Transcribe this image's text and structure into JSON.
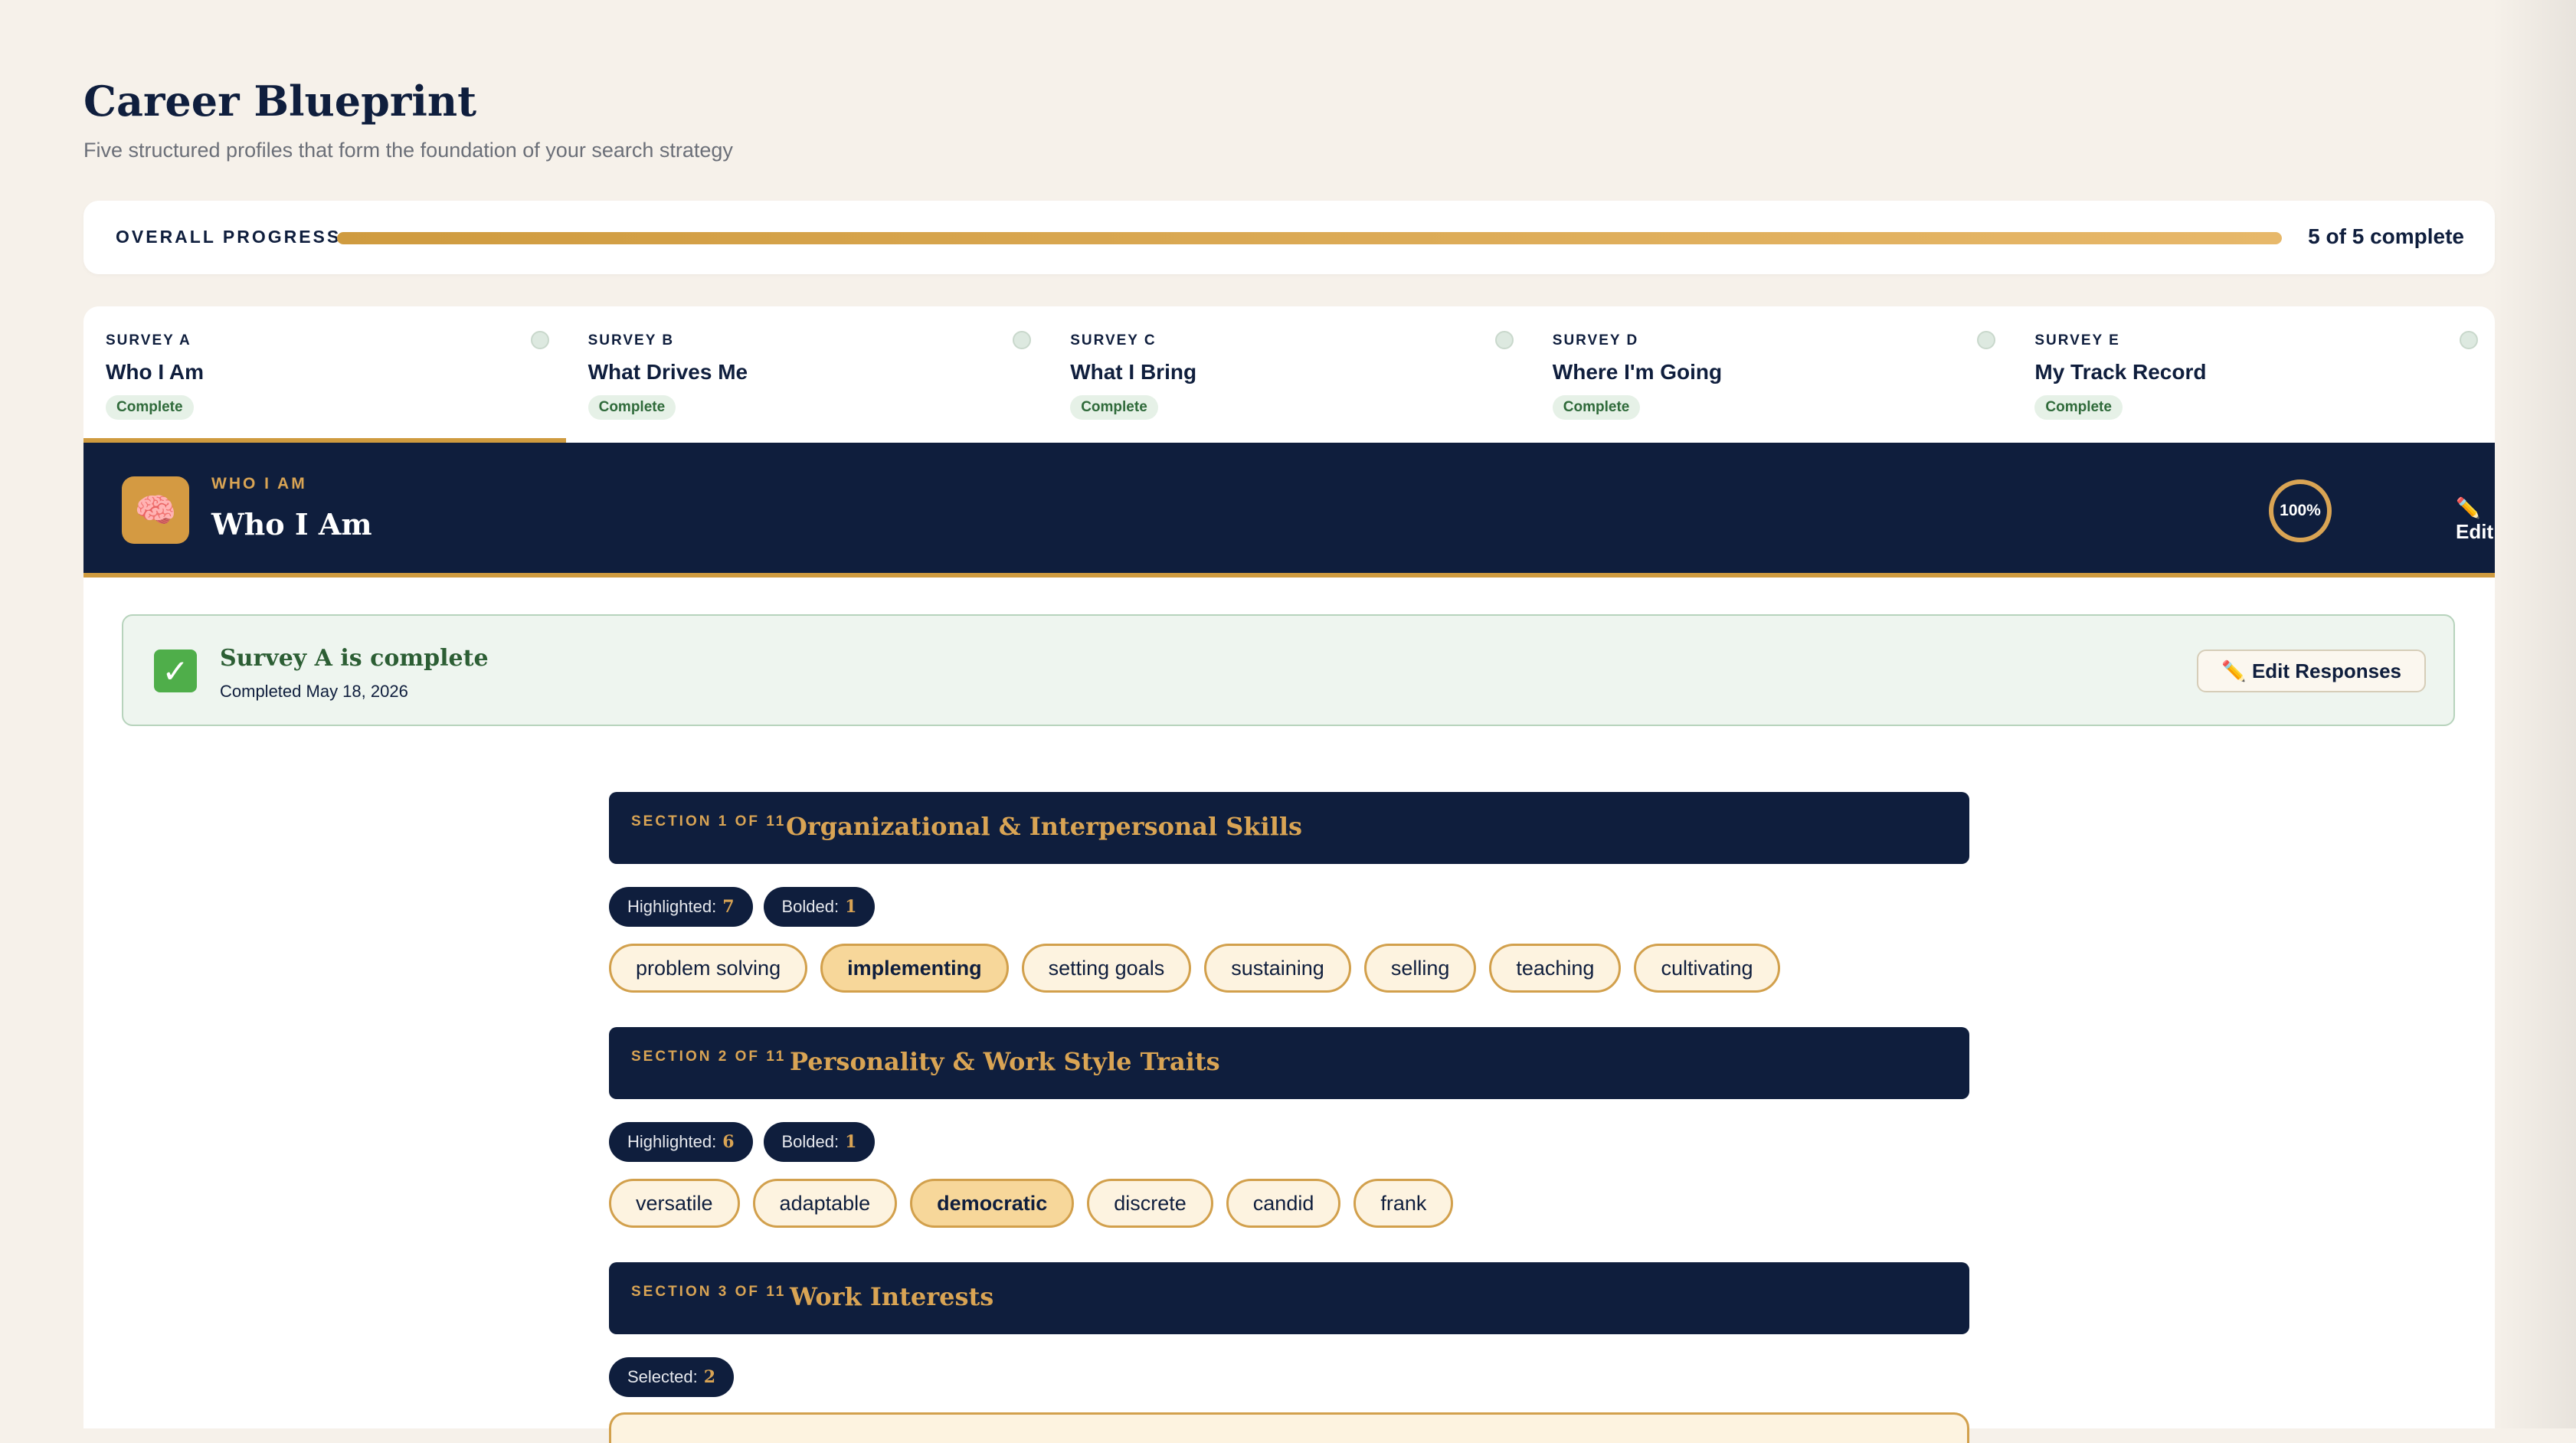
{
  "page": {
    "title": "Career Blueprint",
    "subtitle": "Five structured profiles that form the foundation of your search strategy"
  },
  "progress": {
    "label": "OVERALL PROGRESS",
    "count_text": "5 of 5 complete",
    "fraction": 1.0
  },
  "tabs": [
    {
      "kicker": "SURVEY A",
      "name": "Who I Am",
      "badge": "Complete"
    },
    {
      "kicker": "SURVEY B",
      "name": "What Drives Me",
      "badge": "Complete"
    },
    {
      "kicker": "SURVEY C",
      "name": "What I Bring",
      "badge": "Complete"
    },
    {
      "kicker": "SURVEY D",
      "name": "Where I'm Going",
      "badge": "Complete"
    },
    {
      "kicker": "SURVEY E",
      "name": "My Track Record",
      "badge": "Complete"
    }
  ],
  "active_tab": 0,
  "survey": {
    "icon": "brain-icon",
    "icon_glyph": "🧠",
    "kicker": "WHO I AM",
    "title": "Who I Am",
    "percent": "100%",
    "edit_label": "✏️ Edit"
  },
  "banner": {
    "title": "Survey A is complete",
    "date": "Completed May 18, 2026",
    "check_glyph": "✓",
    "edit_label": "✏️ Edit Responses"
  },
  "sections": [
    {
      "kicker": "SECTION 1 OF 11",
      "title": "Organizational & Interpersonal Skills",
      "stats": [
        {
          "label": "Highlighted:",
          "value": "7"
        },
        {
          "label": "Bolded:",
          "value": "1"
        }
      ],
      "chips": [
        {
          "text": "problem solving",
          "bold": false
        },
        {
          "text": "implementing",
          "bold": true
        },
        {
          "text": "setting goals",
          "bold": false
        },
        {
          "text": "sustaining",
          "bold": false
        },
        {
          "text": "selling",
          "bold": false
        },
        {
          "text": "teaching",
          "bold": false
        },
        {
          "text": "cultivating",
          "bold": false
        }
      ]
    },
    {
      "kicker": "SECTION 2 OF 11",
      "title": "Personality & Work Style Traits",
      "stats": [
        {
          "label": "Highlighted:",
          "value": "6"
        },
        {
          "label": "Bolded:",
          "value": "1"
        }
      ],
      "chips": [
        {
          "text": "versatile",
          "bold": false
        },
        {
          "text": "adaptable",
          "bold": false
        },
        {
          "text": "democratic",
          "bold": true
        },
        {
          "text": "discrete",
          "bold": false
        },
        {
          "text": "candid",
          "bold": false
        },
        {
          "text": "frank",
          "bold": false
        }
      ]
    },
    {
      "kicker": "SECTION 3 OF 11",
      "title": "Work Interests",
      "stats": [
        {
          "label": "Selected:",
          "value": "2"
        }
      ],
      "chips": []
    }
  ]
}
